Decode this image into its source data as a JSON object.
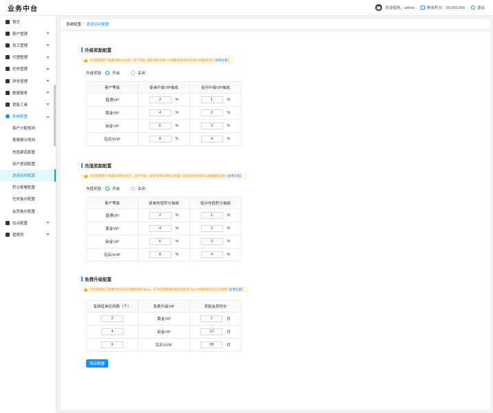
{
  "app": {
    "title": "业务中台"
  },
  "header": {
    "welcome": "欢迎使用，admin",
    "points": "剩余积分：99,999,999",
    "logout": "退出"
  },
  "sidebar": {
    "items": [
      {
        "label": "首页",
        "icon": "home-icon"
      },
      {
        "label": "客户管理",
        "icon": "user-icon"
      },
      {
        "label": "员工管理",
        "icon": "id-card-icon"
      },
      {
        "label": "代理管理",
        "icon": "agent-icon"
      },
      {
        "label": "任务管理",
        "icon": "task-icon"
      },
      {
        "label": "财务管理",
        "icon": "finance-icon"
      },
      {
        "label": "数据报表",
        "icon": "report-icon"
      },
      {
        "label": "销售工具",
        "icon": "tool-icon"
      },
      {
        "label": "系统配置",
        "icon": "settings-icon"
      }
    ],
    "sub_items": [
      "客户分配规则",
      "客服展示规则",
      "充值渠道配置",
      "用户提现配置",
      "邀请返利配置",
      "积分套餐配置",
      "任务售价配置",
      "会员售价配置"
    ],
    "tail_items": [
      {
        "label": "站点配置",
        "icon": "share-icon"
      },
      {
        "label": "管理员",
        "icon": "admin-icon"
      }
    ]
  },
  "breadcrumb": {
    "parent": "系统配置",
    "sep": "/",
    "current": "邀请返利配置"
  },
  "upgrade": {
    "title": "升级奖励配置",
    "notice": "您可配置客户邀请升级VIP返点，客户奖励=邀客/提升升级VIP返额*提客/提升升级VIP抽成比例",
    "notice_link": "【查看位置】",
    "switch_label": "升级奖励",
    "on": "开启",
    "off": "关闭",
    "headers": [
      "客户等级",
      "徒弟升级VIP抽成",
      "徒孙升级VIP抽成"
    ],
    "rows": [
      {
        "level": "普通VIP",
        "a": "2",
        "b": "1"
      },
      {
        "level": "黄金VIP",
        "a": "4",
        "b": "2"
      },
      {
        "level": "铂金VIP",
        "a": "6",
        "b": "3"
      },
      {
        "level": "钻石SVIP",
        "a": "8",
        "b": "4"
      }
    ],
    "unit": "%"
  },
  "recharge": {
    "title": "充值奖励配置",
    "notice": "您可配置客户邀请充值积分返点，客户奖励 = 徒弟/徒孙充值积分金额 * 徒弟/徒孙充值积分金额抽成比例",
    "notice_link": "【查看位置】",
    "switch_label": "充值奖励",
    "on": "开启",
    "off": "关闭",
    "headers": [
      "客户等级",
      "徒弟充值积分抽成",
      "徒孙充值积分抽成"
    ],
    "rows": [
      {
        "level": "普通VIP",
        "a": "2",
        "b": "1"
      },
      {
        "level": "黄金VIP",
        "a": "4",
        "b": "2"
      },
      {
        "level": "铂金VIP",
        "a": "6",
        "b": "3"
      },
      {
        "level": "钻石SVIP",
        "a": "8",
        "b": "4"
      }
    ],
    "unit": "%"
  },
  "free": {
    "title": "免费升级配置",
    "notice": "您可配置客户邀请达到有效徒弟数免费升级vip，有效徒弟数值即邀请注册进行过VIP升级/充值与任务消费",
    "notice_link": "【查看位置】",
    "headers": [
      "有效徒弟达到数（个）",
      "免费升级VIP",
      "奖励会员时长"
    ],
    "rows": [
      {
        "count": "2",
        "vip": "黄金VIP",
        "months": "1"
      },
      {
        "count": "4",
        "vip": "铂金VIP",
        "months": "12"
      },
      {
        "count": "6",
        "vip": "钻石SVIP",
        "months": "99"
      }
    ],
    "unit": "月"
  },
  "save_label": "保存配置"
}
